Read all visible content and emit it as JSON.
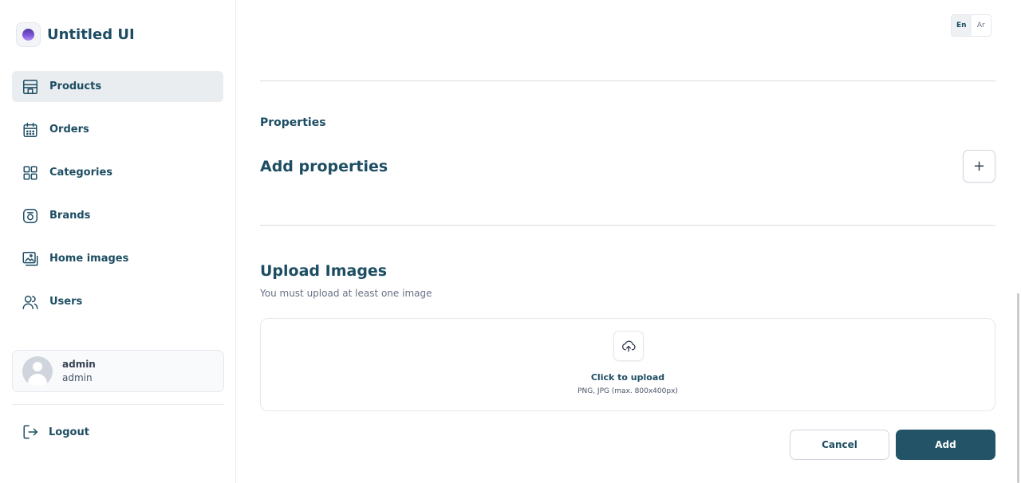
{
  "brand": {
    "name": "Untitled UI"
  },
  "sidebar": {
    "items": [
      {
        "label": "Products",
        "icon": "store-icon",
        "active": true
      },
      {
        "label": "Orders",
        "icon": "calendar-icon",
        "active": false
      },
      {
        "label": "Categories",
        "icon": "grid-icon",
        "active": false
      },
      {
        "label": "Brands",
        "icon": "brand-icon",
        "active": false
      },
      {
        "label": "Home images",
        "icon": "images-icon",
        "active": false
      },
      {
        "label": "Users",
        "icon": "users-icon",
        "active": false
      }
    ],
    "user": {
      "name": "admin",
      "role": "admin"
    },
    "logout_label": "Logout"
  },
  "language": {
    "options": [
      "En",
      "Ar"
    ],
    "selected": "En"
  },
  "properties": {
    "section_label": "Properties",
    "title": "Add properties",
    "add_button_label": "+"
  },
  "upload": {
    "title": "Upload Images",
    "subtitle": "You must upload at least one image",
    "click_label": "Click to upload",
    "hint": "PNG, JPG (max. 800x400px)"
  },
  "actions": {
    "cancel_label": "Cancel",
    "add_label": "Add"
  },
  "colors": {
    "primary": "#225366",
    "text_heading": "#1d4d63",
    "active_nav_bg": "#eaedf0"
  }
}
